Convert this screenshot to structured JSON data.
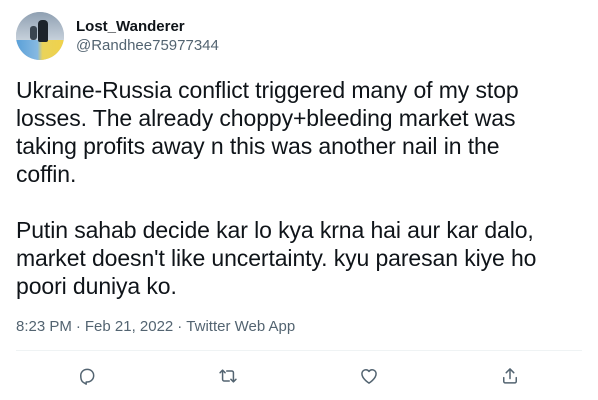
{
  "user": {
    "display_name": "Lost_Wanderer",
    "handle": "@Randhee75977344"
  },
  "tweet": {
    "text": "Ukraine-Russia conflict triggered many of my stop\nlosses. The already choppy+bleeding market was\ntaking profits away n this was another nail in the\ncoffin.\n\nPutin sahab decide kar lo kya krna hai aur kar dalo,\nmarket doesn't like uncertainty. kyu paresan kiye ho\npoori duniya ko.",
    "time": "8:23 PM",
    "separator": "·",
    "date": "Feb 21, 2022",
    "source": "Twitter Web App"
  },
  "actions": [
    {
      "icon": "reply-icon"
    },
    {
      "icon": "retweet-icon"
    },
    {
      "icon": "like-icon"
    },
    {
      "icon": "share-icon"
    }
  ],
  "colors": {
    "text": "#0f1419",
    "secondary": "#536471",
    "divider": "#eff3f4",
    "background": "#ffffff"
  }
}
